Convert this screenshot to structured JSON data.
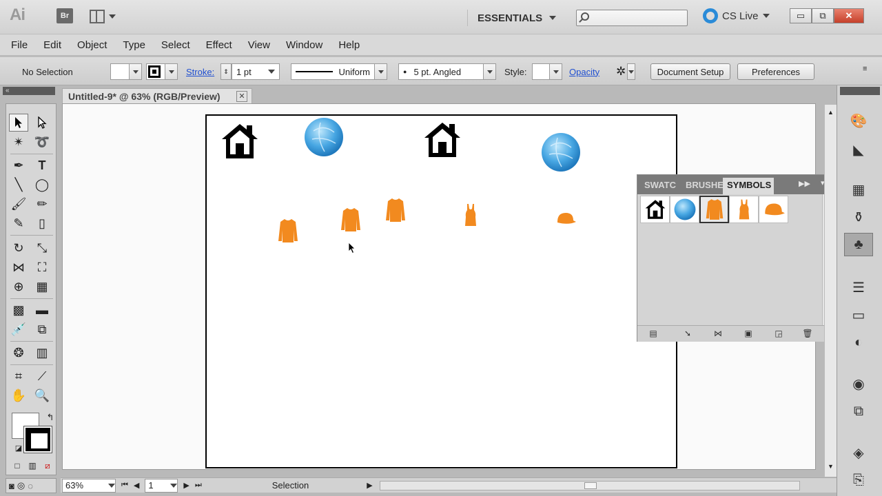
{
  "app": {
    "logo": "Ai",
    "bridge": "Br",
    "workspace": "ESSENTIALS",
    "search_placeholder": "",
    "cs_live": "CS Live",
    "window_min": "▭",
    "window_max": "⧉",
    "window_close": "✕"
  },
  "menubar": [
    "File",
    "Edit",
    "Object",
    "Type",
    "Select",
    "Effect",
    "View",
    "Window",
    "Help"
  ],
  "control_bar": {
    "selection_state": "No Selection",
    "stroke_label": "Stroke:",
    "stroke_weight": "1 pt",
    "profile": "Uniform",
    "brush": "5 pt. Angled",
    "style_label": "Style:",
    "opacity_label": "Opacity",
    "document_setup": "Document Setup",
    "preferences": "Preferences"
  },
  "document": {
    "tab_title": "Untitled-9* @ 63% (RGB/Preview)",
    "close": "✕"
  },
  "status_bar": {
    "zoom": "63%",
    "artboard": "1",
    "tool_status": "Selection"
  },
  "symbols_panel": {
    "tabs": [
      "SWATC",
      "BRUSHE",
      "SYMBOLS"
    ],
    "active_tab": "SYMBOLS",
    "symbols": [
      "house",
      "blue-globe",
      "jacket",
      "tank-top",
      "cap"
    ],
    "selected_symbol": "jacket"
  },
  "canvas_objects": [
    "house",
    "blue-globe",
    "house",
    "blue-globe",
    "jacket",
    "jacket",
    "jacket",
    "tank-top",
    "cap"
  ],
  "colors": {
    "accent_orange": "#f28a1f",
    "globe_blue": "#48a7e3",
    "panel_gray": "#d6d6d6",
    "close_red": "#c6402a"
  }
}
